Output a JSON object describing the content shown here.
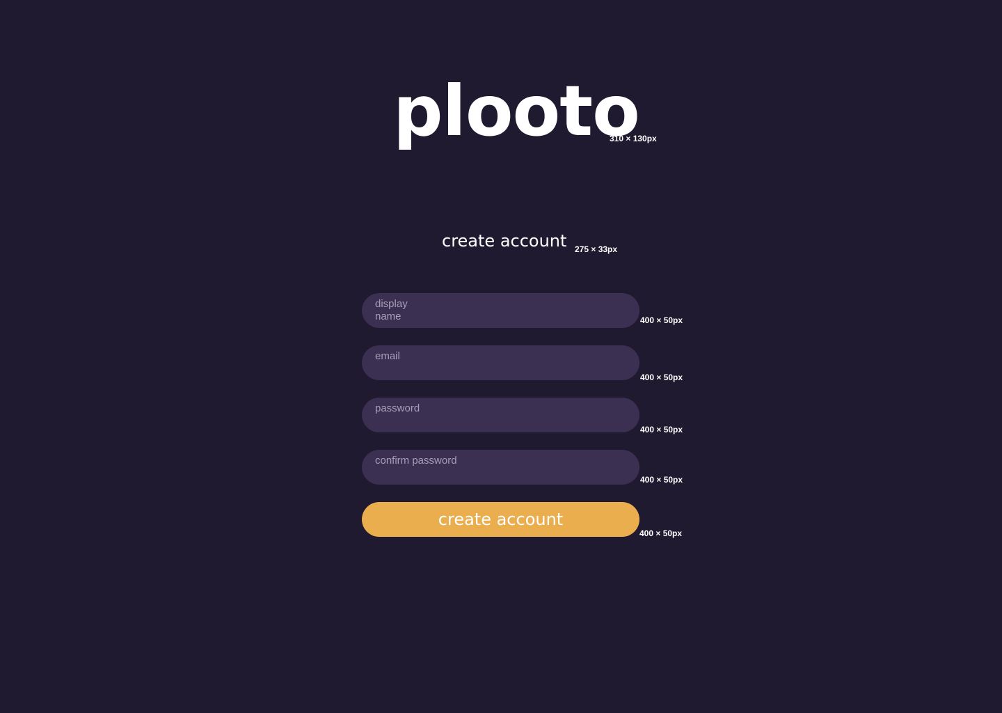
{
  "brand": {
    "logo_text": "plooto",
    "logo_size_note": "310 × 130px"
  },
  "heading": {
    "title": "create account",
    "size_note": "275 × 33px"
  },
  "form": {
    "fields": [
      {
        "placeholder": "display name",
        "size_note": "400 × 50px"
      },
      {
        "placeholder": "email",
        "size_note": "400 × 50px"
      },
      {
        "placeholder": "password",
        "size_note": "400 × 50px"
      },
      {
        "placeholder": "confirm password",
        "size_note": "400 × 50px"
      }
    ],
    "submit": {
      "label": "create account",
      "size_note": "400 × 50px"
    }
  },
  "colors": {
    "background": "#1f1a30",
    "field_background": "#3b2f52",
    "placeholder_text": "#a79fb8",
    "accent_button": "#eaae4e",
    "text": "#ffffff"
  }
}
